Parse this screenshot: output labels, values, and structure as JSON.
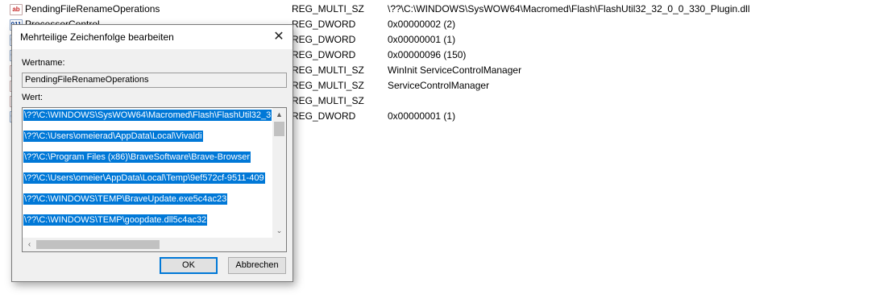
{
  "registry": {
    "rows": [
      {
        "icon": "ab",
        "name": "PendingFileRenameOperations",
        "type": "REG_MULTI_SZ",
        "data": "\\??\\C:\\WINDOWS\\SysWOW64\\Macromed\\Flash\\FlashUtil32_32_0_0_330_Plugin.dll"
      },
      {
        "icon": "011",
        "name": "ProcessorControl",
        "type": "REG_DWORD",
        "data": "0x00000002 (2)"
      },
      {
        "icon": "011",
        "name": "",
        "type": "REG_DWORD",
        "data": "0x00000001 (1)"
      },
      {
        "icon": "011",
        "name": "",
        "type": "REG_DWORD",
        "data": "0x00000096 (150)"
      },
      {
        "icon": "ab",
        "name": "",
        "type": "REG_MULTI_SZ",
        "data": "WinInit ServiceControlManager"
      },
      {
        "icon": "ab",
        "name": "",
        "type": "REG_MULTI_SZ",
        "data": "ServiceControlManager"
      },
      {
        "icon": "ab",
        "name": "",
        "type": "REG_MULTI_SZ",
        "data": ""
      },
      {
        "icon": "011",
        "name": "",
        "type": "REG_DWORD",
        "data": "0x00000001 (1)"
      }
    ]
  },
  "dialog": {
    "title": "Mehrteilige Zeichenfolge bearbeiten",
    "close_glyph": "✕",
    "name_label": "Wertname:",
    "name_value": "PendingFileRenameOperations",
    "value_label": "Wert:",
    "value_lines": [
      "\\??\\C:\\WINDOWS\\SysWOW64\\Macromed\\Flash\\FlashUtil32_3",
      "\\??\\C:\\Users\\omeierad\\AppData\\Local\\Vivaldi",
      "\\??\\C:\\Program Files (x86)\\BraveSoftware\\Brave-Browser",
      "\\??\\C:\\Users\\omeier\\AppData\\Local\\Temp\\9ef572cf-9511-409",
      "\\??\\C:\\WINDOWS\\TEMP\\BraveUpdate.exe5c4ac23",
      "\\??\\C:\\WINDOWS\\TEMP\\goopdate.dll5c4ac32"
    ],
    "ok_label": "OK",
    "cancel_label": "Abbrechen",
    "scroll_up": "▲",
    "scroll_down": "⌄",
    "scroll_left": "‹",
    "scroll_right": "›"
  },
  "colors": {
    "selection": "#0078d7",
    "dialog_bg": "#f0f0f0"
  }
}
